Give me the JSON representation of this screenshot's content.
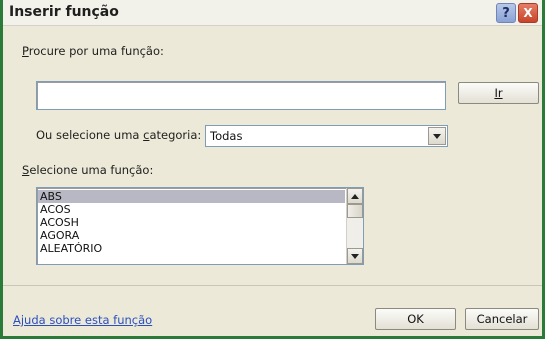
{
  "dialog": {
    "title": "Inserir função",
    "help_glyph": "?",
    "close_glyph": "X"
  },
  "search": {
    "label_first": "P",
    "label_rest": "rocure por uma função:",
    "value": "",
    "go_button_label": "Ir"
  },
  "category": {
    "label_pre": "Ou selecione uma ",
    "label_accel": "c",
    "label_post": "ategoria:",
    "selected": "Todas"
  },
  "functions": {
    "label_first": "S",
    "label_rest": "elecione uma função:",
    "items": [
      "ABS",
      "ACOS",
      "ACOSH",
      "AGORA",
      "ALEATÓRIO"
    ],
    "selected_index": 0
  },
  "footer": {
    "help_link": "Ajuda sobre esta função",
    "ok_label": "OK",
    "cancel_label": "Cancelar"
  },
  "colors": {
    "window_border": "#2a7a3a",
    "dialog_bg": "#ece9d8",
    "link": "#2b4fbf",
    "selection": "#b7b8c4"
  },
  "icons": {
    "help": "help-icon",
    "close": "close-icon",
    "dropdown": "chevron-down-icon",
    "scroll_up": "scroll-up-icon",
    "scroll_down": "scroll-down-icon"
  }
}
